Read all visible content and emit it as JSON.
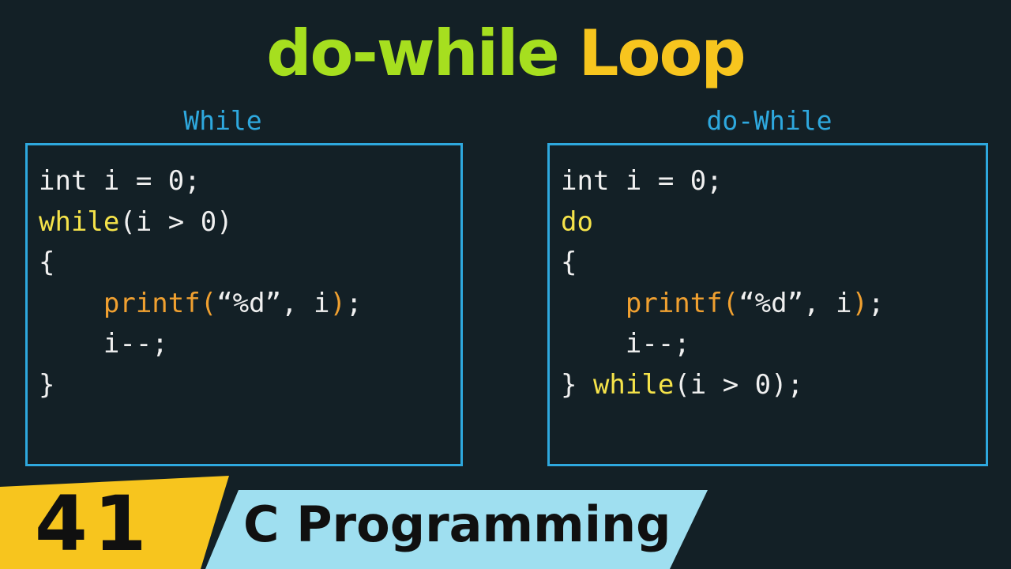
{
  "title": {
    "part1": "do-while",
    "part2": "Loop"
  },
  "left_panel": {
    "label": "While",
    "lines": {
      "l1": "int i = 0;",
      "l2_kw": "while",
      "l2_rest": "(i > 0)",
      "l3": "{",
      "l4_indent": "    ",
      "l4_fn": "printf(",
      "l4_str": "“%d”, i",
      "l4_close": ")",
      "l4_end": ";",
      "l5": "    i--;",
      "l6": "}"
    }
  },
  "right_panel": {
    "label": "do-While",
    "lines": {
      "l1": "int i = 0;",
      "l2_kw": "do",
      "l3": "{",
      "l4_indent": "    ",
      "l4_fn": "printf(",
      "l4_str": "“%d”, i",
      "l4_close": ")",
      "l4_end": ";",
      "l5": "    i--;",
      "l6_brace": "} ",
      "l6_kw": "while",
      "l6_rest": "(i > 0);"
    }
  },
  "banner": {
    "episode": "41",
    "series": "C Programming"
  },
  "colors": {
    "background": "#132026",
    "title_green": "#a6df1f",
    "title_yellow": "#f7c51e",
    "panel_border": "#2ea8de",
    "keyword": "#f5e34a",
    "function": "#f0a030",
    "banner_yellow": "#f7c51e",
    "banner_cyan": "#9fdff0"
  }
}
